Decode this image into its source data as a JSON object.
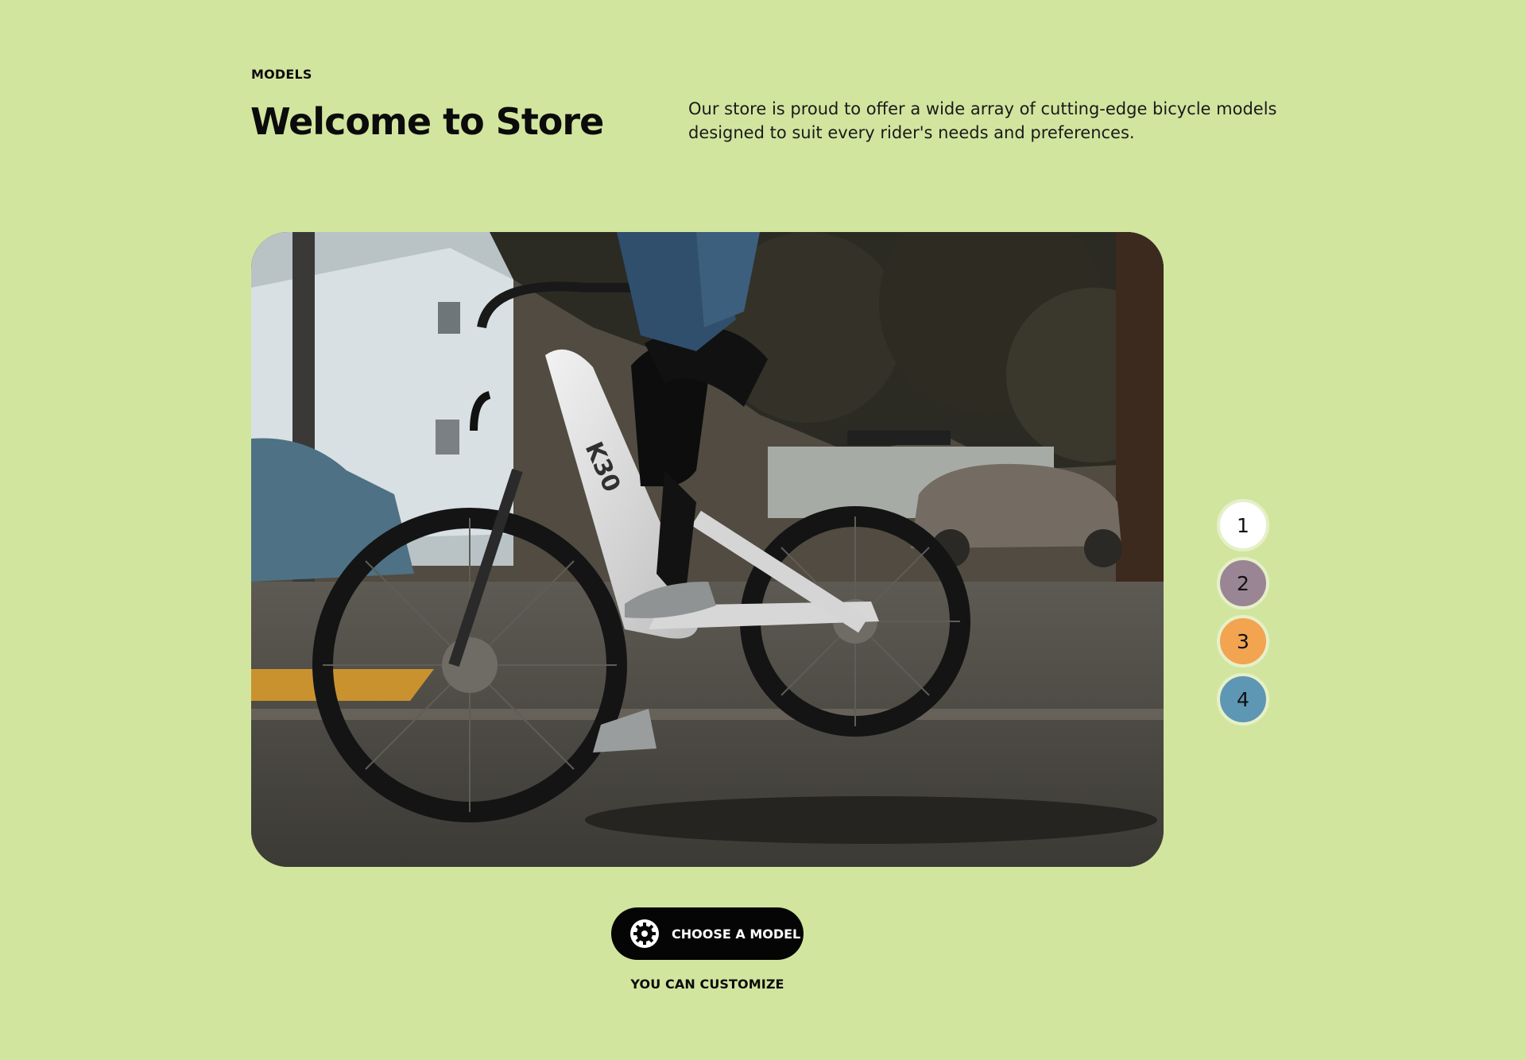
{
  "header": {
    "eyebrow": "MODELS",
    "title": "Welcome to Store",
    "description": "Our store is proud to offer a wide array of cutting-edge bicycle models designed to suit every rider's needs and preferences."
  },
  "hero": {
    "frame_brand": "K30"
  },
  "pager": {
    "items": [
      {
        "label": "1",
        "color": "#ffffff"
      },
      {
        "label": "2",
        "color": "#9a8595"
      },
      {
        "label": "3",
        "color": "#f2a451"
      },
      {
        "label": "4",
        "color": "#5e97b3"
      }
    ]
  },
  "cta": {
    "icon": "gear-icon",
    "label": "CHOOSE A MODEL"
  },
  "caption": "YOU CAN CUSTOMIZE"
}
